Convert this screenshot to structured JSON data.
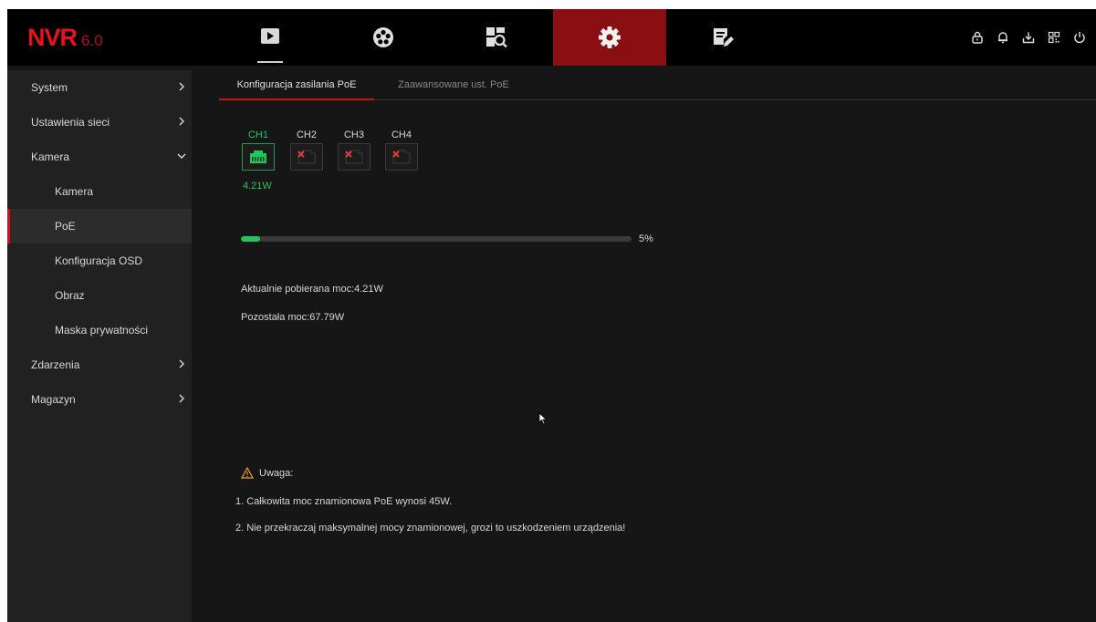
{
  "app": {
    "logo_main": "NVR",
    "logo_version": "6.0",
    "nav": [
      {
        "name": "nav-live-view",
        "icon": "play-icon",
        "active": false
      },
      {
        "name": "nav-playback",
        "icon": "film-reel-icon",
        "active": false
      },
      {
        "name": "nav-search",
        "icon": "search-grid-icon",
        "active": false
      },
      {
        "name": "nav-settings",
        "icon": "gear-icon",
        "active": true
      },
      {
        "name": "nav-maintenance",
        "icon": "edit-wrench-icon",
        "active": false
      }
    ],
    "top_icons": [
      "lock-icon",
      "bell-icon",
      "download-icon",
      "qr-code-icon",
      "power-icon"
    ],
    "colors": {
      "brand": "#e8101a",
      "active_tab": "#8a0f12",
      "ok": "#22c55e",
      "error": "#e53935"
    }
  },
  "sidebar": {
    "items": [
      {
        "label": "System",
        "level": 1,
        "chevron": "right"
      },
      {
        "label": "Ustawienia sieci",
        "level": 1,
        "chevron": "right"
      },
      {
        "label": "Kamera",
        "level": 1,
        "chevron": "down"
      },
      {
        "label": "Kamera",
        "level": 2
      },
      {
        "label": "PoE",
        "level": 2,
        "active": true
      },
      {
        "label": "Konfiguracja OSD",
        "level": 2
      },
      {
        "label": "Obraz",
        "level": 2
      },
      {
        "label": "Maska prywatności",
        "level": 2
      },
      {
        "label": "Zdarzenia",
        "level": 1,
        "chevron": "right"
      },
      {
        "label": "Magazyn",
        "level": 1,
        "chevron": "right"
      }
    ]
  },
  "main": {
    "tabs": [
      {
        "label": "Konfiguracja zasilania PoE",
        "active": true
      },
      {
        "label": "Zaawansowane ust. PoE",
        "active": false
      }
    ],
    "channels": [
      {
        "label": "CH1",
        "connected": true,
        "watt": "4.21W"
      },
      {
        "label": "CH2",
        "connected": false
      },
      {
        "label": "CH3",
        "connected": false
      },
      {
        "label": "CH4",
        "connected": false
      }
    ],
    "progress": {
      "percent": 5,
      "label": "5%"
    },
    "current_power": "Aktualnie pobierana moc:4.21W",
    "remaining_power": "Pozostała moc:67.79W",
    "note": {
      "title": "Uwaga:",
      "lines": [
        "1. Całkowita moc znamionowa PoE wynosi 45W.",
        "2. Nie przekraczaj maksymalnej mocy znamionowej, grozi to uszkodzeniem urządzenia!"
      ]
    }
  }
}
